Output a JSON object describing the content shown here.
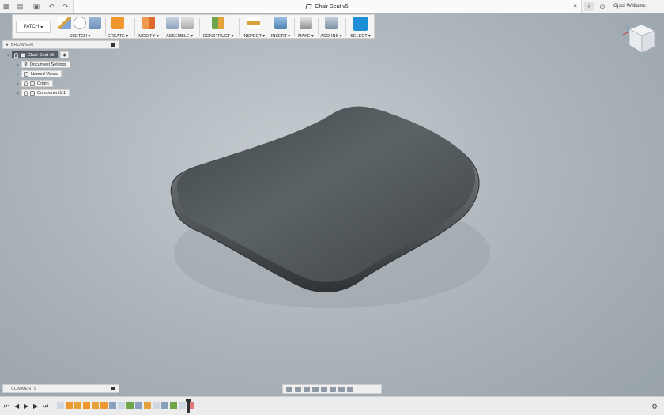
{
  "window": {
    "document_title": "Chair Seat v5",
    "user_name": "Gjasi Williams",
    "add_tab": "+",
    "close_tab": "×"
  },
  "toolbar": {
    "workspace": "PATCH",
    "groups": [
      {
        "label": "SKETCH"
      },
      {
        "label": "CREATE"
      },
      {
        "label": "MODIFY"
      },
      {
        "label": "ASSEMBLE"
      },
      {
        "label": "CONSTRUCT"
      },
      {
        "label": "INSPECT"
      },
      {
        "label": "INSERT"
      },
      {
        "label": "MAKE"
      },
      {
        "label": "ADD-INS"
      },
      {
        "label": "SELECT"
      }
    ]
  },
  "browser": {
    "title": "BROWSER",
    "root": "Chair Seat v5",
    "nodes": [
      "Document Settings",
      "Named Views",
      "Origin",
      "Component1:1"
    ]
  },
  "comments": {
    "title": "COMMENTS"
  },
  "colors": {
    "accent": "#1d8fd6",
    "create": "#f0962f",
    "modify": "#e5863a",
    "construct": "#6ea44a",
    "inspect": "#d9a23a",
    "seat": "#4f5559",
    "viewport": "#aeb6bc"
  },
  "icons": {
    "app_grid": "grid-icon",
    "file": "file-icon",
    "save": "save-icon",
    "undo": "undo-icon",
    "redo": "redo-icon",
    "viewcube": "viewcube-icon",
    "settings": "gear-icon"
  }
}
